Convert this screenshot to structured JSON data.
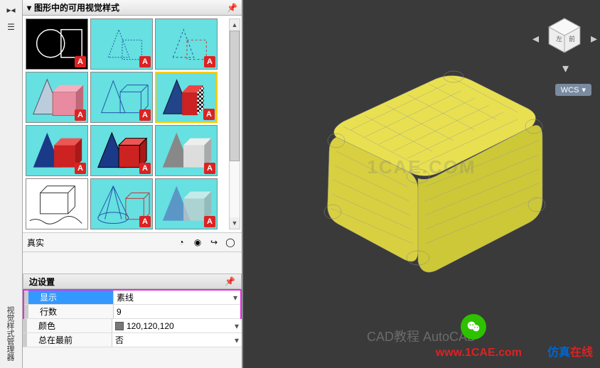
{
  "panel": {
    "title": "图形中的可用视觉样式",
    "selected_style": "真实",
    "styles_count": 12
  },
  "edge_section": {
    "title": "边设置",
    "rows": [
      {
        "label": "显示",
        "value": "素线",
        "selected": true,
        "dropdown": true
      },
      {
        "label": "行数",
        "value": "9",
        "dropdown": false
      },
      {
        "label": "颜色",
        "value": "120,120,120",
        "swatch": true,
        "dropdown": true
      },
      {
        "label": "总在最前",
        "value": "否",
        "dropdown": true
      }
    ]
  },
  "viewport": {
    "wcs_label": "WCS"
  },
  "toolbar": {
    "manager_label": "视觉样式管理器"
  },
  "watermarks": {
    "center": "1CAE.COM",
    "site": "www.1CAE.com",
    "brand_a": "仿真",
    "brand_b": "在线",
    "cad_label": "CAD教程 AutoCAD"
  }
}
